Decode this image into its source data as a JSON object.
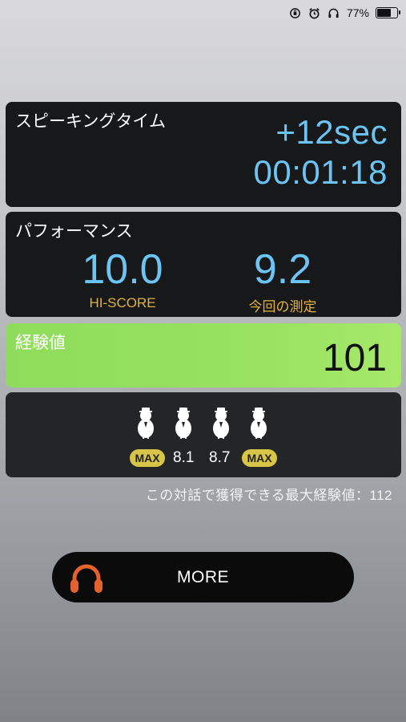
{
  "status_bar": {
    "battery_text": "77%",
    "battery_level": 0.77,
    "icons": [
      "rotation-lock-icon",
      "alarm-icon",
      "headphones-icon",
      "battery-icon"
    ]
  },
  "speaking_time": {
    "title": "スピーキングタイム",
    "delta": "+12sec",
    "time": "00:01:18"
  },
  "performance": {
    "title": "パフォーマンス",
    "hi_score_value": "10.0",
    "hi_score_label": "HI-SCORE",
    "current_value": "9.2",
    "current_label": "今回の測定"
  },
  "experience": {
    "title": "経験値",
    "value": "101"
  },
  "persons": {
    "count": 4,
    "badge1": "MAX",
    "score2": "8.1",
    "score3": "8.7",
    "badge4": "MAX"
  },
  "max_note": "この対話で獲得できる最大経験値：112",
  "more_button": {
    "label": "MORE",
    "icon": "headphones-icon"
  },
  "colors": {
    "accent_blue": "#6cc4f4",
    "accent_gold": "#e2b23c",
    "exp_green": "#97e25f",
    "badge_yellow": "#d8c447",
    "headphones_orange": "#e4622d"
  }
}
